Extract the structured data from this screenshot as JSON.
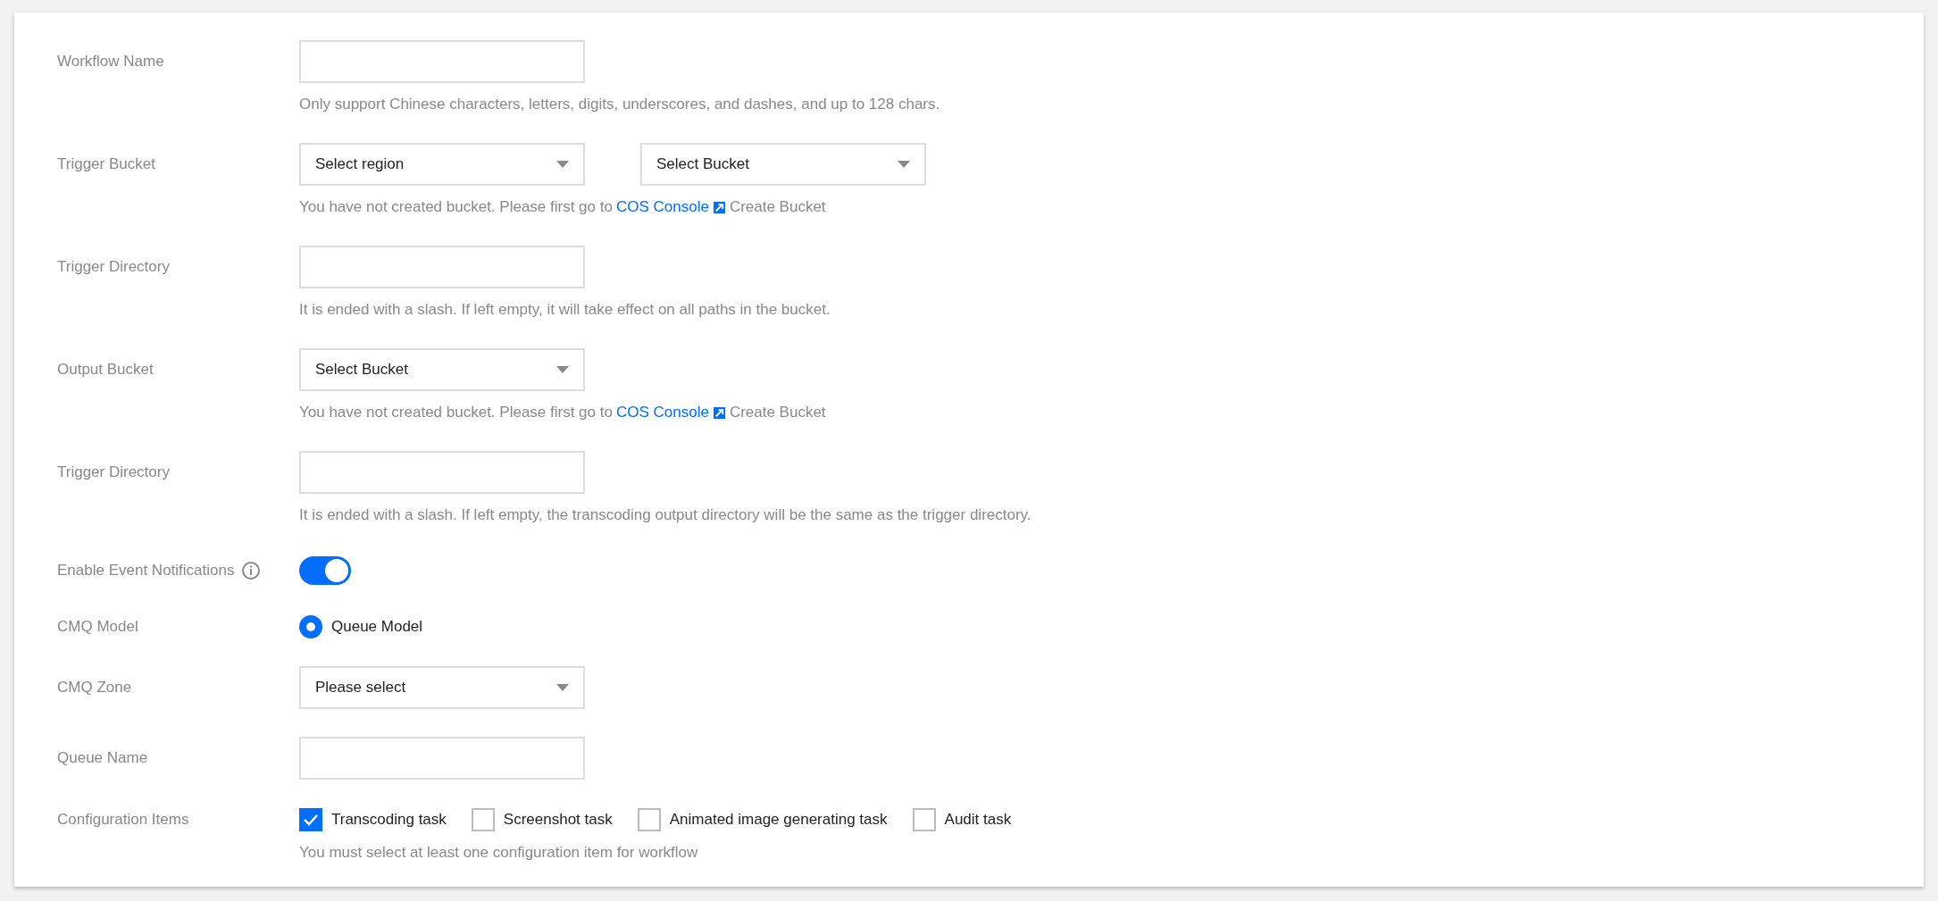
{
  "rows": [
    {
      "kind": "input",
      "label": "Workflow Name",
      "help": "Only support Chinese characters, letters, digits, underscores, and dashes, and up to 128 chars."
    },
    {
      "kind": "selects",
      "label": "Trigger Bucket",
      "selects": [
        "Select region",
        "Select Bucket"
      ],
      "help_parts": [
        "You have not created bucket. Please first go to",
        "COS Console",
        "Create Bucket"
      ]
    },
    {
      "kind": "input",
      "label": "Trigger Directory",
      "help": "It is ended with a slash. If left empty, it will take effect on all paths in the bucket."
    },
    {
      "kind": "selects",
      "label": "Output Bucket",
      "selects": [
        "Select Bucket"
      ],
      "help_parts": [
        "You have not created bucket. Please first go to",
        "COS Console",
        "Create Bucket"
      ]
    },
    {
      "kind": "input",
      "label": "Trigger Directory",
      "help": "It is ended with a slash. If left empty, the transcoding output directory will be the same as the trigger directory."
    },
    {
      "kind": "toggle",
      "label": "Enable Event Notifications",
      "on": true
    },
    {
      "kind": "radio",
      "label": "CMQ Model",
      "options": [
        {
          "label": "Queue Model",
          "selected": true
        }
      ]
    },
    {
      "kind": "selects",
      "label": "CMQ Zone",
      "selects": [
        "Please select"
      ]
    },
    {
      "kind": "input",
      "label": "Queue Name"
    },
    {
      "kind": "checks",
      "label": "Configuration Items",
      "options": [
        {
          "label": "Transcoding task",
          "checked": true
        },
        {
          "label": "Screenshot task",
          "checked": false
        },
        {
          "label": "Animated image generating task",
          "checked": false
        },
        {
          "label": "Audit task",
          "checked": false
        }
      ],
      "help": "You must select at least one configuration item for workflow"
    }
  ]
}
